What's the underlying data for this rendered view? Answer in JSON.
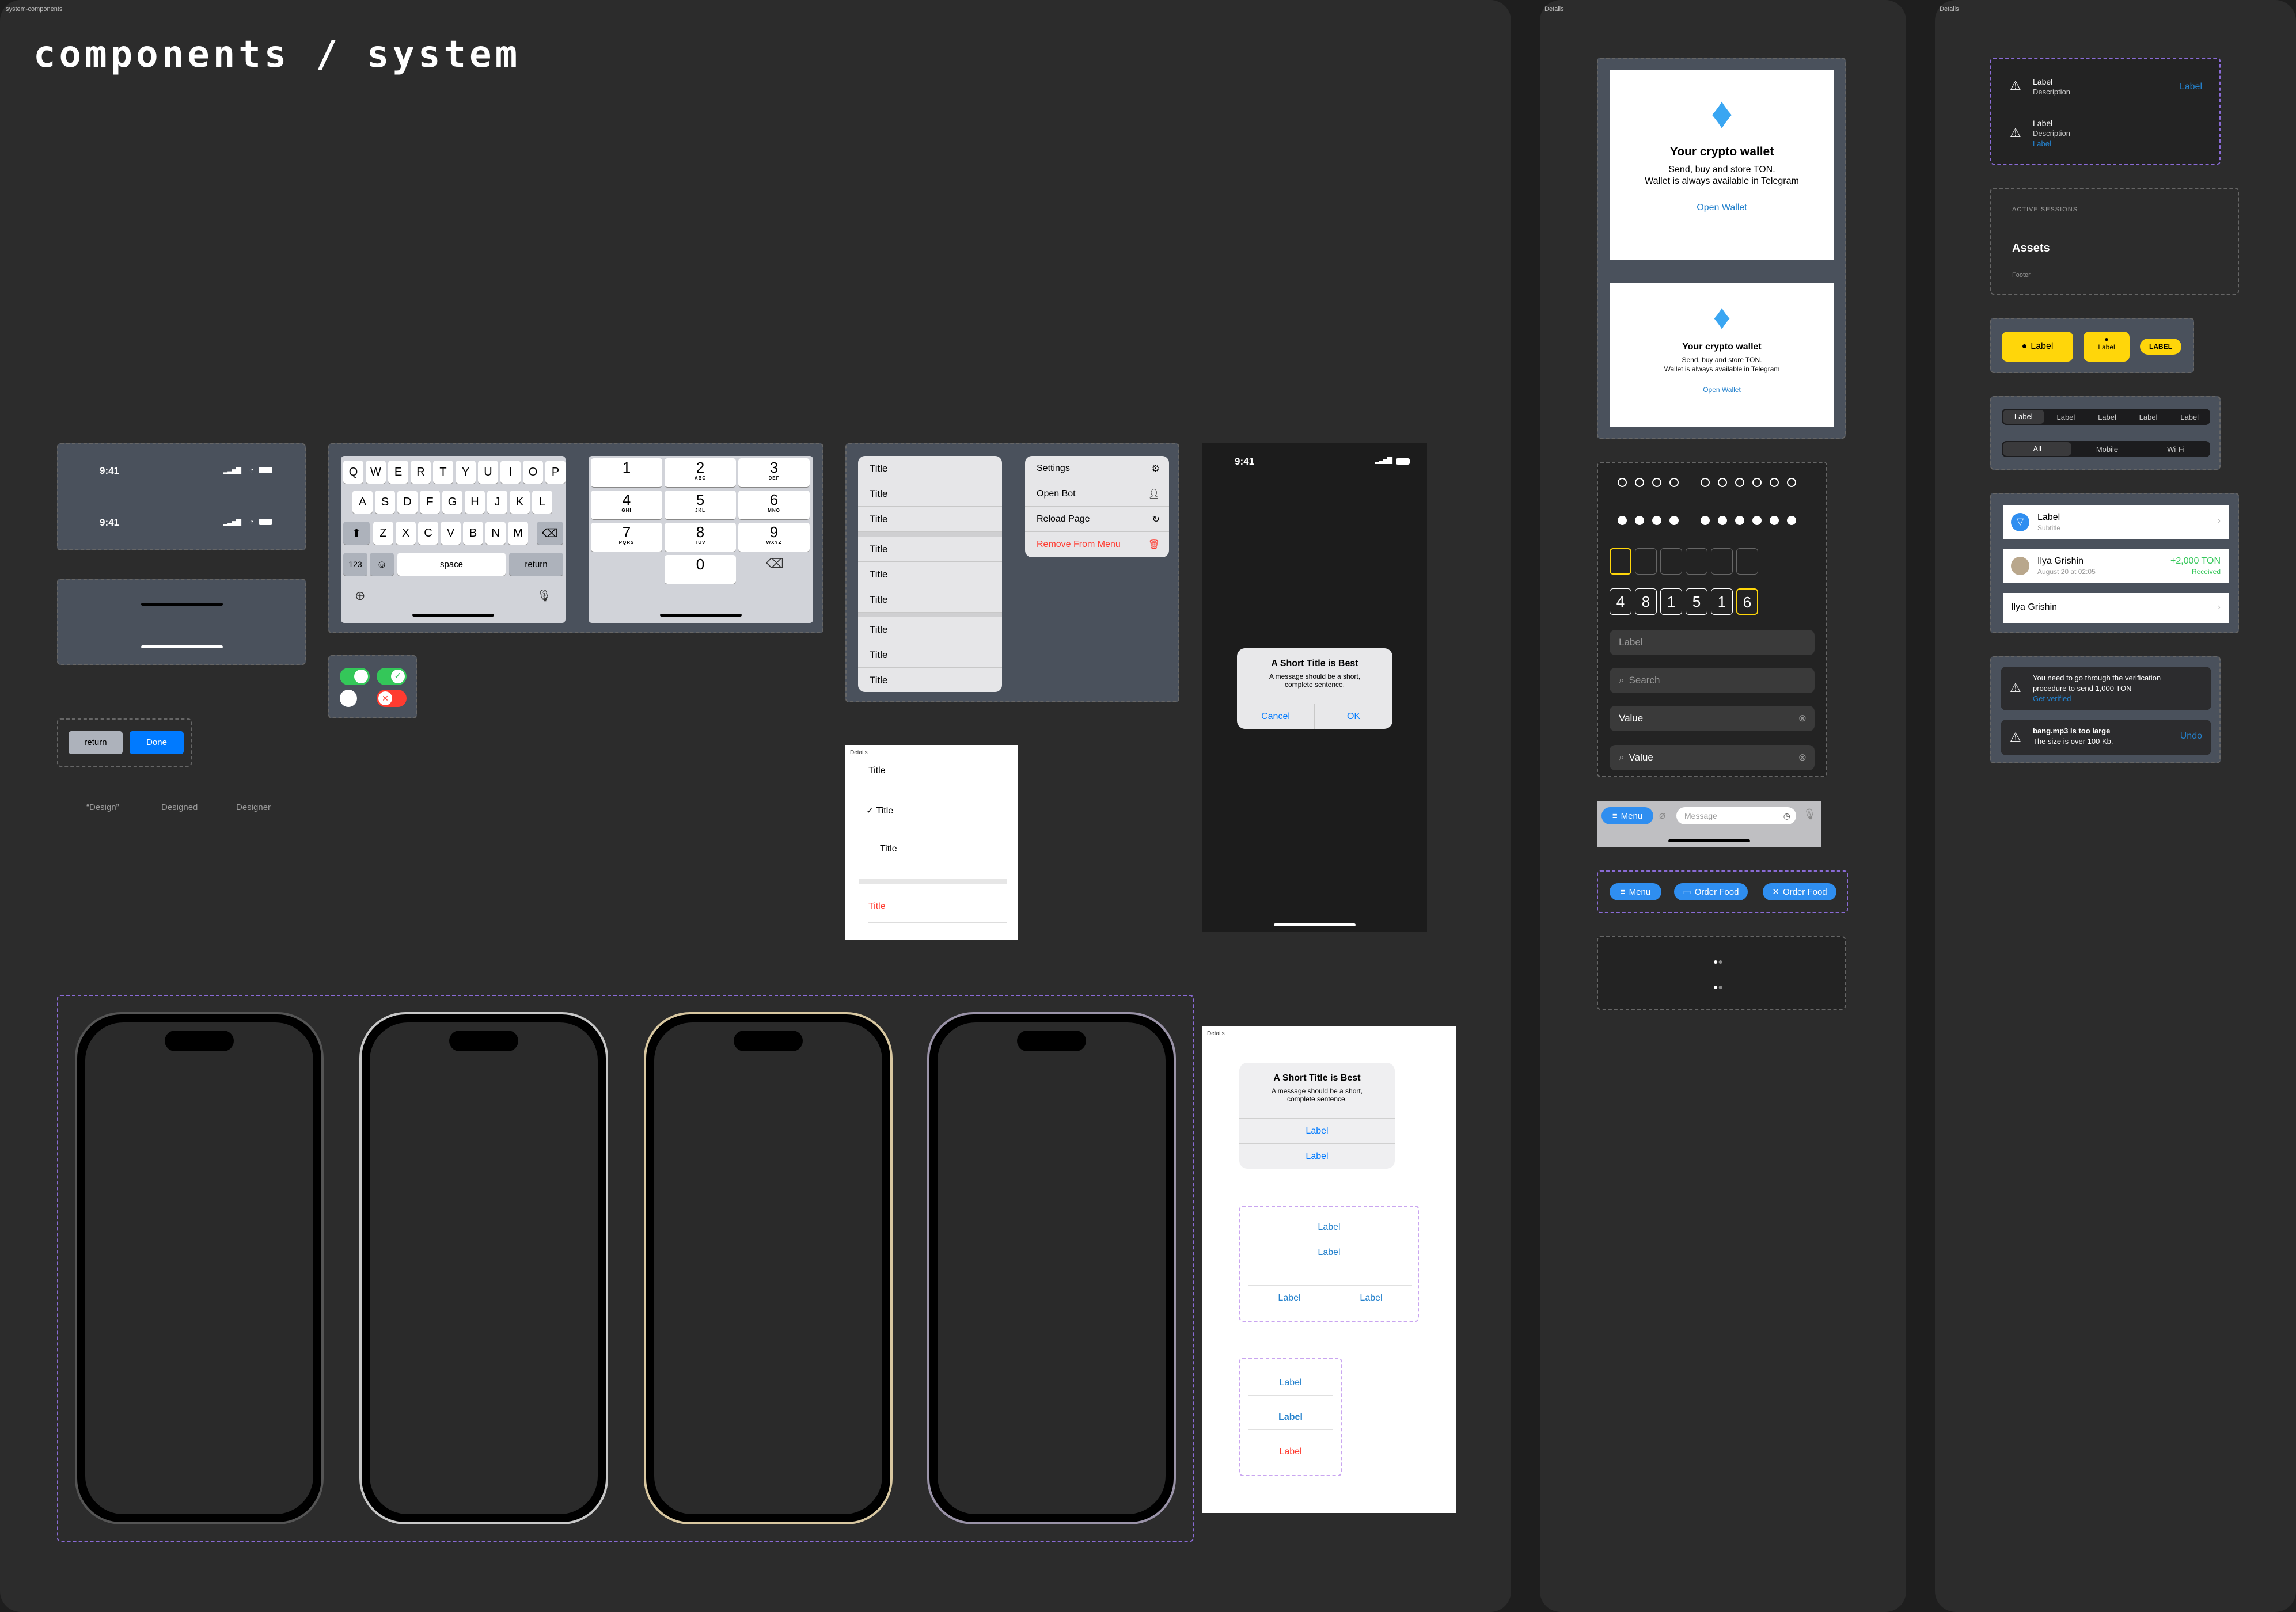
{
  "frames": {
    "main_label": "system-components",
    "details_label": "Details",
    "details2_label": "Details"
  },
  "title": "components / system",
  "status": {
    "time": "9:41"
  },
  "keyboard": {
    "row1": [
      "Q",
      "W",
      "E",
      "R",
      "T",
      "Y",
      "U",
      "I",
      "O",
      "P"
    ],
    "row2": [
      "A",
      "S",
      "D",
      "F",
      "G",
      "H",
      "J",
      "K",
      "L"
    ],
    "row3": [
      "Z",
      "X",
      "C",
      "V",
      "B",
      "N",
      "M"
    ],
    "num": "123",
    "space": "space",
    "return": "return",
    "numpad": [
      {
        "n": "1",
        "l": ""
      },
      {
        "n": "2",
        "l": "ABC"
      },
      {
        "n": "3",
        "l": "DEF"
      },
      {
        "n": "4",
        "l": "GHI"
      },
      {
        "n": "5",
        "l": "JKL"
      },
      {
        "n": "6",
        "l": "MNO"
      },
      {
        "n": "7",
        "l": "PQRS"
      },
      {
        "n": "8",
        "l": "TUV"
      },
      {
        "n": "9",
        "l": "WXYZ"
      },
      {
        "n": "0",
        "l": ""
      }
    ]
  },
  "buttons": {
    "return": "return",
    "done": "Done"
  },
  "typography": [
    "“Design”",
    "Designed",
    "Designer"
  ],
  "menu_list": [
    "Title",
    "Title",
    "Title",
    "Title",
    "Title",
    "Title",
    "Title",
    "Title",
    "Title"
  ],
  "context_menu": {
    "items": [
      "Settings",
      "Open Bot",
      "Reload Page"
    ],
    "danger": "Remove From Menu"
  },
  "alert": {
    "title": "A Short Title is Best",
    "message": "A message should be a short, complete sentence.",
    "cancel": "Cancel",
    "ok": "OK"
  },
  "details_list": {
    "label": "Details",
    "items": [
      "Title",
      "Title",
      "Title"
    ],
    "danger": "Title"
  },
  "alert2": {
    "label": "Details",
    "title": "A Short Title is Best",
    "message": "A message should be a short, complete sentence.",
    "btn1": "Label",
    "btn2": "Label"
  },
  "action_group": {
    "items": [
      "Label",
      "Label"
    ],
    "row": [
      "Label",
      "Label"
    ]
  },
  "action_group2": {
    "items": [
      "Label",
      "Label"
    ],
    "danger": "Label"
  },
  "wallet": {
    "title": "Your crypto wallet",
    "line1": "Send, buy and store TON.",
    "line2": "Wallet is always available in Telegram",
    "link": "Open Wallet"
  },
  "code": {
    "digits": [
      "4",
      "8",
      "1",
      "5",
      "1",
      "6"
    ]
  },
  "fields": {
    "label": "Label",
    "search": "Search",
    "value": "Value",
    "search_value": "Value"
  },
  "chatbar": {
    "menu": "Menu",
    "placeholder": "Message"
  },
  "chips": {
    "menu": "Menu",
    "order": "Order Food",
    "order2": "Order Food"
  },
  "banner": {
    "label": "Label",
    "desc": "Description",
    "action": "Label",
    "label2": "Label",
    "desc2": "Description",
    "link2": "Label"
  },
  "section": {
    "header": "ACTIVE SESSIONS",
    "item": "Assets",
    "footer": "Footer"
  },
  "yellow_buttons": {
    "b1": "Label",
    "b2": "Label",
    "b3": "LABEL"
  },
  "segments": {
    "row1": [
      "Label",
      "Label",
      "Label",
      "Label",
      "Label"
    ],
    "row2": [
      "All",
      "Mobile",
      "Wi-Fi"
    ]
  },
  "cells": {
    "c1_title": "Label",
    "c1_sub": "Subtitle",
    "c2_title": "Ilya Grishin",
    "c2_sub": "August 20 at 02:05",
    "c2_amount": "+2,000 TON",
    "c2_status": "Received",
    "c3_title": "Ilya Grishin"
  },
  "toasts": {
    "t1_line1": "You need to go through the verification",
    "t1_line2": "procedure to send 1,000 TON",
    "t1_link": "Get verified",
    "t2_title": "bang.mp3 is too large",
    "t2_sub": "The size is over 100 Kb.",
    "t2_action": "Undo"
  },
  "colors": {
    "accent": "#2481cc",
    "yellow": "#ffd60a",
    "danger": "#ff3b30",
    "green": "#34c759"
  }
}
